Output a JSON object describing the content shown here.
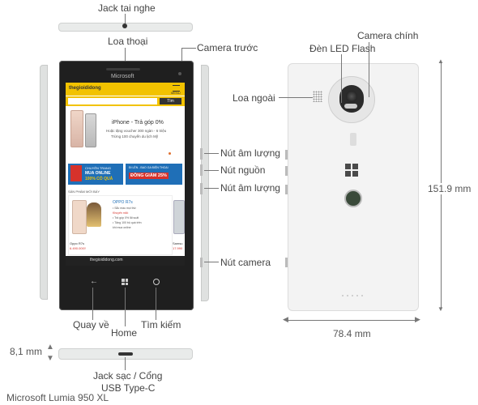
{
  "labels": {
    "jack": "Jack tai nghe",
    "loa_thoai": "Loa thoại",
    "camera_truoc": "Camera trước",
    "camera_chinh": "Camera chính",
    "den_flash": "Đèn LED Flash",
    "loa_ngoai": "Loa ngoài",
    "nut_am_luong_1": "Nút âm lượng",
    "nut_nguon": "Nút nguồn",
    "nut_am_luong_2": "Nút âm lượng",
    "nut_camera": "Nút camera",
    "quay_ve": "Quay về",
    "home": "Home",
    "tim_kiem": "Tìm kiếm",
    "day": "8,1 mm",
    "jack_sac_1": "Jack sạc / Cổng",
    "jack_sac_2": "USB Type-C",
    "height": "151.9 mm",
    "width": "78.4 mm",
    "caption": "Microsoft Lumia 950 XL"
  },
  "phone": {
    "brand": "Microsoft",
    "logo": "thegioididong",
    "menu": "MENU",
    "search_btn": "Tìm",
    "banner_title": "iPhone - Trả góp 0%",
    "banner_line1": "Hoặc tặng voucher 300 ngàn - 6 triệu",
    "banner_line2": "Trừng 100 chuyến du lịch Mỹ",
    "promo_left_1": "CHUYÊN TRANG",
    "promo_left_2": "MUA ONLINE",
    "promo_left_3": "100% CÓ QUÀ",
    "promo_right_1": "ĐI LÊN - BAO GA ĐIỆN THOẠI",
    "promo_right_2": "ĐỒNG GIẢM 25%",
    "section": "SẢN PHẨM MỚI BÁY",
    "prod_name": "OPPO R7s",
    "prod_line1": "• Sắc màu mọi thứ",
    "prod_line2": "Khuyến mãi:",
    "prod_line3": "• Trả góp 0% lãi suất",
    "prod_line4": "• Tặng 100 bộ quà trên",
    "prod_line5": "khi mua online",
    "prod_price_label": "Oppo R7s",
    "prod_price": "6.490.000₫",
    "prod2_label": "Samsu",
    "prod2_price": "17.990",
    "url": "thegioididong.com"
  },
  "colors": {
    "accent_yellow": "#f2c200",
    "brand_red": "#d6322b",
    "link_blue": "#1f6fb7"
  }
}
